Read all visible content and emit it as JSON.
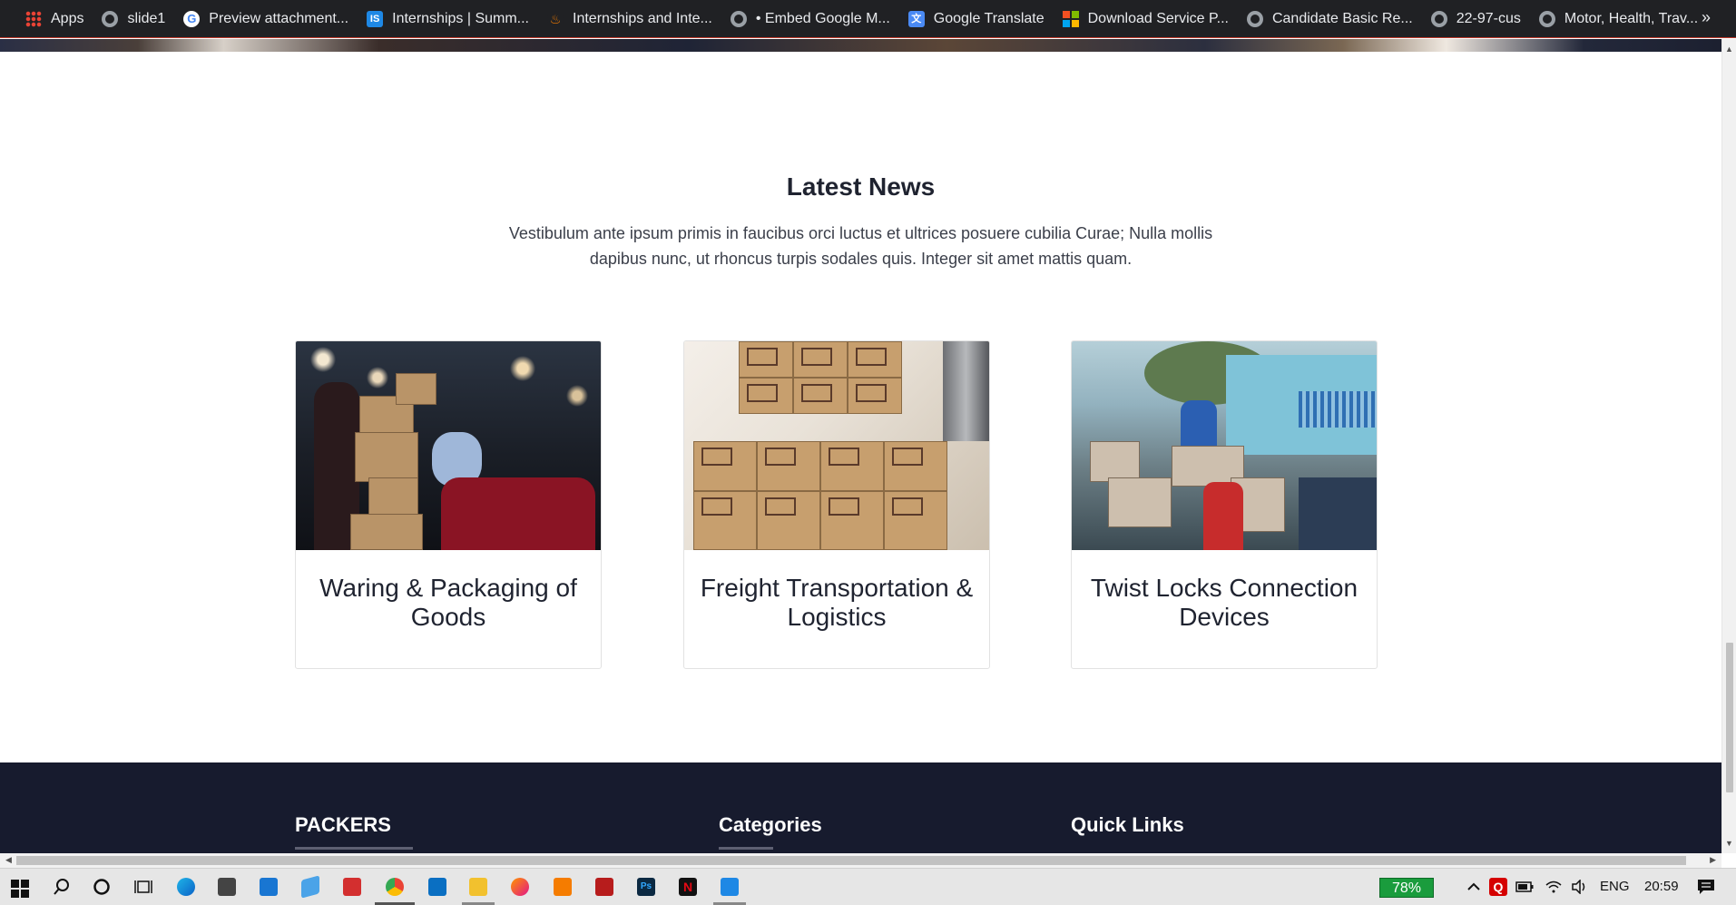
{
  "bookmarks": {
    "items": [
      {
        "label": "Apps",
        "icon": "apps-grid-icon"
      },
      {
        "label": "slide1",
        "icon": "globe-icon"
      },
      {
        "label": "Preview attachment...",
        "icon": "google-icon"
      },
      {
        "label": "Internships | Summ...",
        "icon": "internshala-icon"
      },
      {
        "label": "Internships and Inte...",
        "icon": "firebase-icon"
      },
      {
        "label": "• Embed Google M...",
        "icon": "globe-icon"
      },
      {
        "label": "Google Translate",
        "icon": "translate-icon"
      },
      {
        "label": "Download Service P...",
        "icon": "microsoft-icon"
      },
      {
        "label": "Candidate Basic Re...",
        "icon": "globe-icon"
      },
      {
        "label": "22-97-cus",
        "icon": "globe-icon"
      },
      {
        "label": "Motor, Health, Trav...",
        "icon": "globe-icon"
      }
    ],
    "more": "»"
  },
  "news": {
    "title": "Latest News",
    "description": "Vestibulum ante ipsum primis in faucibus orci luctus et ultrices posuere cubilia Curae; Nulla mollis dapibus nunc, ut rhoncus turpis sodales quis. Integer sit amet mattis quam.",
    "cards": [
      {
        "title": "Waring & Packaging of Goods"
      },
      {
        "title": "Freight Transportation & Logistics"
      },
      {
        "title": "Twist Locks Connection Devices"
      }
    ]
  },
  "footer": {
    "col1": "PACKERS",
    "col2": "Categories",
    "col3": "Quick Links"
  },
  "taskbar": {
    "battery": "78%",
    "language": "ENG",
    "time": "20:59"
  }
}
